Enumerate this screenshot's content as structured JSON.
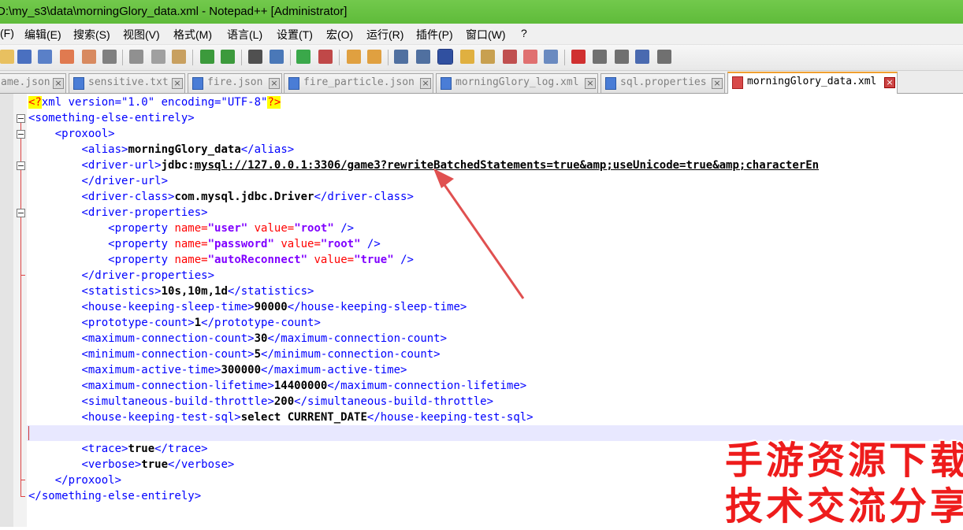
{
  "window": {
    "title": "D:\\my_s3\\data\\morningGlory_data.xml - Notepad++ [Administrator]"
  },
  "menu": [
    "(F)",
    "编辑(E)",
    "搜索(S)",
    "视图(V)",
    "格式(M)",
    "语言(L)",
    "设置(T)",
    "宏(O)",
    "运行(R)",
    "插件(P)",
    "窗口(W)",
    "?"
  ],
  "tabs": [
    {
      "label": "ame.json",
      "active": false
    },
    {
      "label": "sensitive.txt",
      "active": false
    },
    {
      "label": "fire.json",
      "active": false
    },
    {
      "label": "fire_particle.json",
      "active": false
    },
    {
      "label": "morningGlory_log.xml",
      "active": false
    },
    {
      "label": "sql.properties",
      "active": false
    },
    {
      "label": "morningGlory_data.xml",
      "active": true
    }
  ],
  "code": {
    "l1": {
      "o": "<?",
      "a": "xml version=\"1.0\" encoding=\"UTF-8\"",
      "c": "?>"
    },
    "l2": "<something-else-entirely>",
    "l3": "<proxool>",
    "l4": {
      "o": "<alias>",
      "t": "morningGlory_data",
      "c": "</alias>"
    },
    "l5": {
      "o": "<driver-url>",
      "t1": "jdbc:",
      "t2": "mysql://127.0.0.1:3306/game3?rewriteBatchedStatements=true&amp;useUnicode=true&amp;characterEn"
    },
    "l6": "</driver-url>",
    "l7": {
      "o": "<driver-class>",
      "t": "com.mysql.jdbc.Driver",
      "c": "</driver-class>"
    },
    "l8": "<driver-properties>",
    "p1": {
      "n": "\"user\"",
      "v": "\"root\""
    },
    "p2": {
      "n": "\"password\"",
      "v": "\"root\""
    },
    "p3": {
      "n": "\"autoReconnect\"",
      "v": "\"true\""
    },
    "prop_open": "<property ",
    "name_attr": "name=",
    "value_attr": "value=",
    "prop_close": " />",
    "l12": "</driver-properties>",
    "l13": {
      "o": "<statistics>",
      "t": "10s,10m,1d",
      "c": "</statistics>"
    },
    "l14": {
      "o": "<house-keeping-sleep-time>",
      "t": "90000",
      "c": "</house-keeping-sleep-time>"
    },
    "l15": {
      "o": "<prototype-count>",
      "t": "1",
      "c": "</prototype-count>"
    },
    "l16": {
      "o": "<maximum-connection-count>",
      "t": "30",
      "c": "</maximum-connection-count>"
    },
    "l17": {
      "o": "<minimum-connection-count>",
      "t": "5",
      "c": "</minimum-connection-count>"
    },
    "l18": {
      "o": "<maximum-active-time>",
      "t": "300000",
      "c": "</maximum-active-time>"
    },
    "l19": {
      "o": "<maximum-connection-lifetime>",
      "t": "14400000",
      "c": "</maximum-connection-lifetime>"
    },
    "l20": {
      "o": "<simultaneous-build-throttle>",
      "t": "200",
      "c": "</simultaneous-build-throttle>"
    },
    "l21": {
      "o": "<house-keeping-test-sql>",
      "t": "select CURRENT_DATE",
      "c": "</house-keeping-test-sql>"
    },
    "l23": {
      "o": "<trace>",
      "t": "true",
      "c": "</trace>"
    },
    "l24": {
      "o": "<verbose>",
      "t": "true",
      "c": "</verbose>"
    },
    "l25": "</proxool>",
    "l26": "</something-else-entirely>"
  },
  "watermark": {
    "line1": "手游资源下载",
    "line2": "技术交流分享"
  },
  "colors": {
    "titlebar": "#5fbb3a",
    "tag": "#0000ff",
    "attr": "#ff0000",
    "value": "#8000ff",
    "arrow": "#e05050",
    "watermark": "#ee1c1c"
  }
}
